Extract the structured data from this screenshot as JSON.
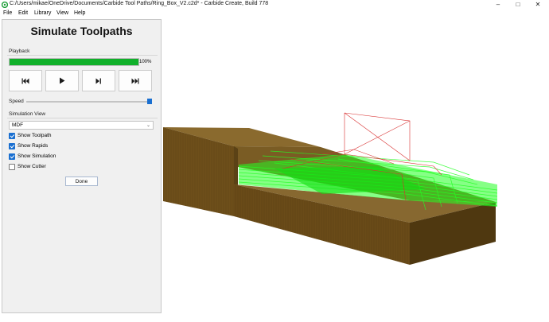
{
  "window": {
    "title": "C:/Users/mikae/OneDrive/Documents/Carbide Tool Paths/Ring_Box_V2.c2d* - Carbide Create, Build 778",
    "minimize": "–",
    "maximize": "□",
    "close": "✕"
  },
  "menu": [
    "File",
    "Edit",
    "Library",
    "View",
    "Help"
  ],
  "panel": {
    "title": "Simulate Toolpaths",
    "playback_label": "Playback",
    "progress": 1.0,
    "progress_text": "100%",
    "speed_label": "Speed",
    "speed_level": 1.0,
    "simulation_view_label": "Simulation View",
    "material": "MDF",
    "options": [
      {
        "label": "Show Toolpath",
        "checked": true
      },
      {
        "label": "Show Rapids",
        "checked": true
      },
      {
        "label": "Show Simulation",
        "checked": true
      },
      {
        "label": "Show Cutter",
        "checked": false
      }
    ],
    "done_label": "Done"
  },
  "colors": {
    "progress": "#10b02a",
    "accent": "#1a6fd0",
    "wood_top": "#8a6a2e",
    "wood_front": "#6e4f1a",
    "wood_side": "#4f3810",
    "toolpath": "#22ff22",
    "rapids": "#d83030"
  },
  "icons": {
    "first": "skip-to-start-icon",
    "play": "play-icon",
    "step": "step-forward-icon",
    "last": "skip-to-end-icon"
  }
}
